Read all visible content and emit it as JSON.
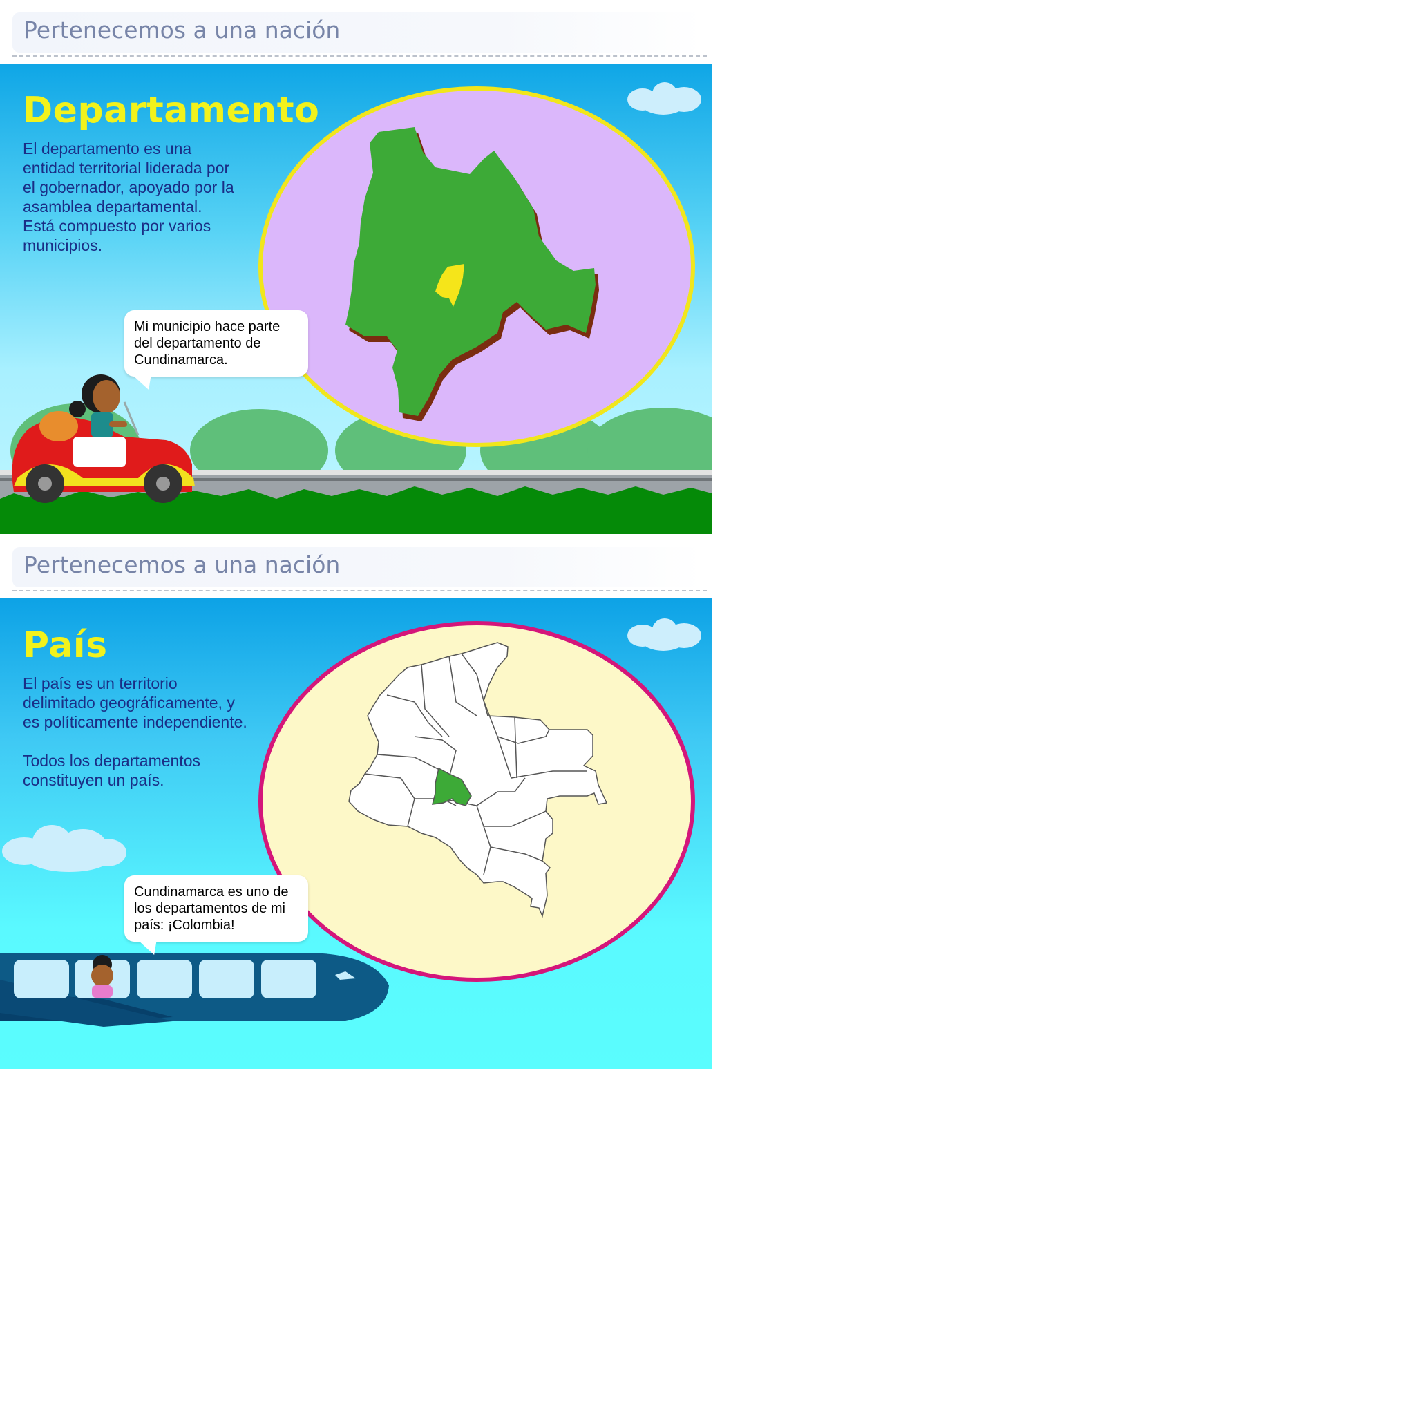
{
  "slides": [
    {
      "header": "Pertenecemos a una nación",
      "title": "Departamento",
      "body": "El departamento es una\nentidad territorial liderada por\nel gobernador, apoyado por la\nasamblea departamental.\nEstá compuesto por varios\nmunicipios.",
      "speech": "Mi municipio hace parte\ndel departamento de\nCundinamarca."
    },
    {
      "header": "Pertenecemos a una nación",
      "title": "País",
      "body": "El país es un territorio\ndelimitado geográficamente, y\nes políticamente independiente.\n\nTodos los departamentos\nconstituyen un país.",
      "speech": "Cundinamarca es uno de\nlos departamentos de mi\npaís: ¡Colombia!"
    }
  ],
  "colors": {
    "title": "#f2f21c",
    "body_text": "#1a2e86",
    "department_fill": "#3daa37",
    "municipality_fill": "#f5e51a",
    "oval1_fill": "#dbb7fb",
    "oval1_border": "#f1e61c",
    "oval2_fill": "#fdf8c8",
    "oval2_border": "#d4167a"
  },
  "icons": [
    "cloud-icon",
    "car-icon",
    "girl-icon",
    "airplane-icon",
    "map-icon"
  ]
}
